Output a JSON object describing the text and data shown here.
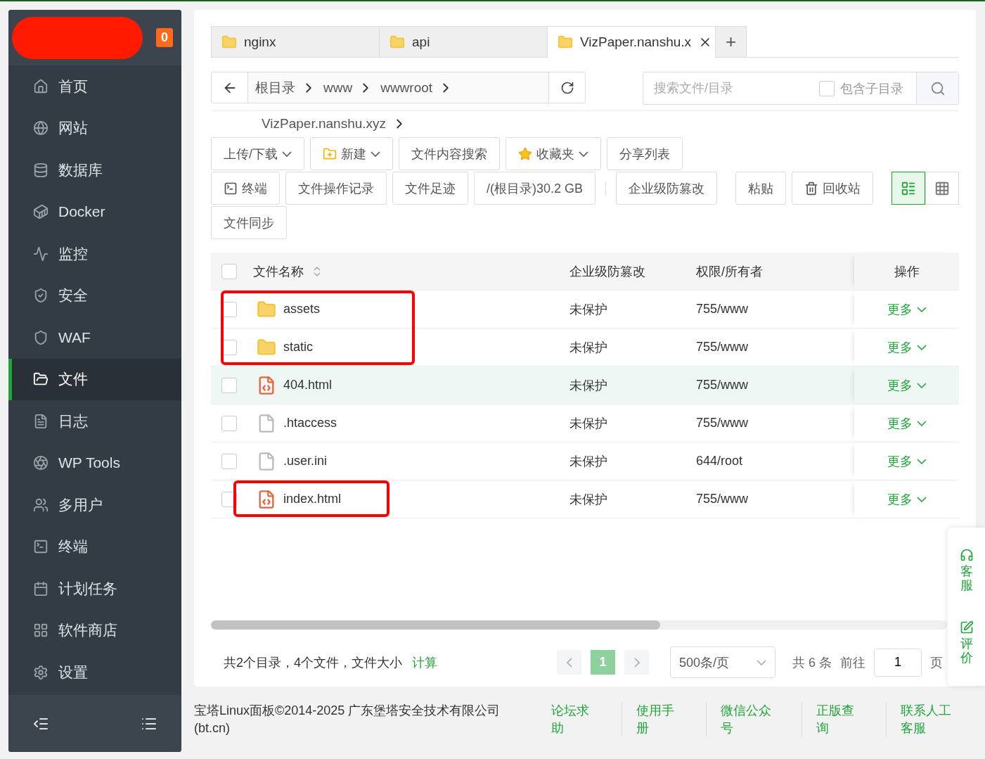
{
  "sidebar": {
    "badge": "0",
    "items": [
      {
        "label": "首页",
        "selected": false
      },
      {
        "label": "网站",
        "selected": false
      },
      {
        "label": "数据库",
        "selected": false
      },
      {
        "label": "Docker",
        "selected": false
      },
      {
        "label": "监控",
        "selected": false
      },
      {
        "label": "安全",
        "selected": false
      },
      {
        "label": "WAF",
        "selected": false
      },
      {
        "label": "文件",
        "selected": true
      },
      {
        "label": "日志",
        "selected": false
      },
      {
        "label": "WP Tools",
        "selected": false
      },
      {
        "label": "多用户",
        "selected": false
      },
      {
        "label": "终端",
        "selected": false
      },
      {
        "label": "计划任务",
        "selected": false
      },
      {
        "label": "软件商店",
        "selected": false
      },
      {
        "label": "设置",
        "selected": false
      }
    ]
  },
  "tabs": [
    {
      "label": "nginx",
      "selected": false,
      "closable": false
    },
    {
      "label": "api",
      "selected": false,
      "closable": false
    },
    {
      "label": "VizPaper.nanshu.x",
      "selected": true,
      "closable": true
    }
  ],
  "new_tab": "+",
  "breadcrumb": [
    "根目录",
    "www",
    "wwwroot",
    "VizPaper.nanshu.xyz"
  ],
  "search": {
    "placeholder": "搜索文件/目录",
    "include_subdirs": {
      "label": "包含子目录",
      "checked": false
    }
  },
  "toolbar": [
    [
      {
        "label": "上传/下载",
        "dropdown": true
      },
      {
        "label": "新建",
        "dropdown": true
      },
      {
        "label": "文件内容搜索",
        "dropdown": false
      },
      {
        "label": "收藏夹",
        "dropdown": true
      },
      {
        "label": "分享列表",
        "dropdown": false
      }
    ],
    [
      {
        "label": "终端",
        "dropdown": false
      },
      {
        "label": "文件操作记录",
        "dropdown": false
      },
      {
        "label": "文件足迹",
        "dropdown": false
      },
      {
        "label": "/(根目录)30.2 GB",
        "dropdown": false
      },
      {
        "label": "企业级防篡改",
        "dropdown": false
      },
      {
        "label": "粘贴",
        "dropdown": false
      },
      {
        "label": "回收站",
        "dropdown": false
      }
    ],
    [
      {
        "label": "文件同步",
        "dropdown": false
      }
    ]
  ],
  "view_modes": [
    {
      "selected": true
    },
    {
      "selected": false
    }
  ],
  "table": {
    "select_all": {
      "checked": false
    },
    "columns": [
      "文件名称",
      "企业级防篡改",
      "权限/所有者",
      "操作"
    ],
    "rows": [
      {
        "kind": "folder",
        "name": "assets",
        "protection": "未保护",
        "permission": "755/www",
        "action": "更多",
        "highlighted": false,
        "marked": true
      },
      {
        "kind": "folder",
        "name": "static",
        "protection": "未保护",
        "permission": "755/www",
        "action": "更多",
        "highlighted": false,
        "marked": true
      },
      {
        "kind": "html",
        "name": "404.html",
        "protection": "未保护",
        "permission": "755/www",
        "action": "更多",
        "highlighted": true,
        "marked": false
      },
      {
        "kind": "file",
        "name": ".htaccess",
        "protection": "未保护",
        "permission": "755/www",
        "action": "更多",
        "highlighted": false,
        "marked": false
      },
      {
        "kind": "file",
        "name": ".user.ini",
        "protection": "未保护",
        "permission": "644/root",
        "action": "更多",
        "highlighted": false,
        "marked": false
      },
      {
        "kind": "html",
        "name": "index.html",
        "protection": "未保护",
        "permission": "755/www",
        "action": "更多",
        "highlighted": false,
        "marked": true
      }
    ]
  },
  "summary": {
    "text": "共2个目录，4个文件，文件大小",
    "link": "计算"
  },
  "pagination": {
    "pages": [
      {
        "label": "1",
        "selected": true
      }
    ],
    "page_size": "500条/页",
    "total": "共 6 条",
    "goto_label": "前往",
    "goto_value": "1",
    "page_suffix": "页"
  },
  "float_widget": [
    "客服",
    "评价"
  ],
  "footer": {
    "copyright": "宝塔Linux面板©2014-2025 广东堡塔安全技术有限公司(bt.cn)",
    "links": [
      "论坛求助",
      "使用手册",
      "微信公众号",
      "正版查询",
      "联系人工客服"
    ]
  }
}
